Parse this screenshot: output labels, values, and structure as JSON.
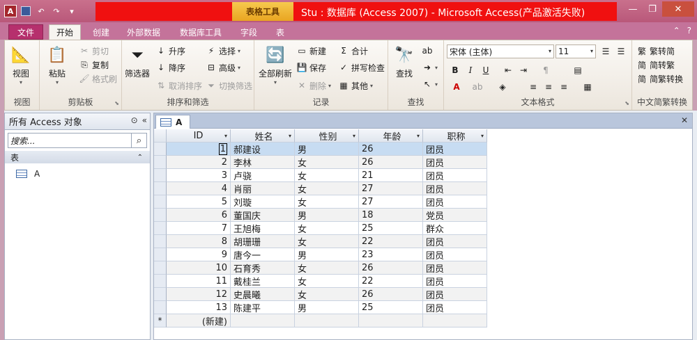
{
  "titlebar": {
    "app_icon": "A",
    "context_tab": "表格工具",
    "title": "Stu : 数据库 (Access 2007) - Microsoft Access(产品激活失败)",
    "icons": [
      "access-app-icon",
      "save-icon",
      "undo-icon",
      "redo-icon",
      "customize-qat-icon"
    ]
  },
  "tabs": [
    {
      "label": "文件"
    },
    {
      "label": "开始"
    },
    {
      "label": "创建"
    },
    {
      "label": "外部数据"
    },
    {
      "label": "数据库工具"
    },
    {
      "label": "字段"
    },
    {
      "label": "表"
    }
  ],
  "ribbon": {
    "view": {
      "button": "视图",
      "group": "视图"
    },
    "clipboard": {
      "paste": "粘贴",
      "cut": "剪切",
      "copy": "复制",
      "format_painter": "格式刷",
      "group": "剪贴板"
    },
    "sort": {
      "filter": "筛选器",
      "asc": "升序",
      "desc": "降序",
      "clear_sort": "取消排序",
      "select": "选择",
      "advanced": "高级",
      "toggle_filter": "切换筛选",
      "group": "排序和筛选"
    },
    "records": {
      "refresh": "全部刷新",
      "new": "新建",
      "save": "保存",
      "delete": "删除",
      "totals": "合计",
      "spelling": "拼写检查",
      "more": "其他",
      "group": "记录"
    },
    "find": {
      "find": "查找",
      "group": "查找"
    },
    "text": {
      "font": "宋体 (主体)",
      "size": "11",
      "group": "文本格式"
    },
    "chinese": {
      "to_simplified": "繁转简",
      "to_traditional": "简转繁",
      "convert": "简繁转换",
      "group": "中文简繁转换"
    }
  },
  "nav": {
    "title": "所有 Access 对象",
    "search_placeholder": "搜索...",
    "group": "表",
    "items": [
      {
        "name": "A"
      }
    ]
  },
  "doc": {
    "tab": "A"
  },
  "table": {
    "columns": [
      "ID",
      "姓名",
      "性别",
      "年龄",
      "职称"
    ],
    "rows": [
      {
        "id": "1",
        "name": "郝建设",
        "sex": "男",
        "age": "26",
        "title": "团员"
      },
      {
        "id": "2",
        "name": "李林",
        "sex": "女",
        "age": "26",
        "title": "团员"
      },
      {
        "id": "3",
        "name": "卢骁",
        "sex": "女",
        "age": "21",
        "title": "团员"
      },
      {
        "id": "4",
        "name": "肖丽",
        "sex": "女",
        "age": "27",
        "title": "团员"
      },
      {
        "id": "5",
        "name": "刘璇",
        "sex": "女",
        "age": "27",
        "title": "团员"
      },
      {
        "id": "6",
        "name": "董国庆",
        "sex": "男",
        "age": "18",
        "title": "党员"
      },
      {
        "id": "7",
        "name": "王旭梅",
        "sex": "女",
        "age": "25",
        "title": "群众"
      },
      {
        "id": "8",
        "name": "胡珊珊",
        "sex": "女",
        "age": "22",
        "title": "团员"
      },
      {
        "id": "9",
        "name": "唐今一",
        "sex": "男",
        "age": "23",
        "title": "团员"
      },
      {
        "id": "10",
        "name": "石育秀",
        "sex": "女",
        "age": "26",
        "title": "团员"
      },
      {
        "id": "11",
        "name": "戴桂兰",
        "sex": "女",
        "age": "22",
        "title": "团员"
      },
      {
        "id": "12",
        "name": "史晨曦",
        "sex": "女",
        "age": "26",
        "title": "团员"
      },
      {
        "id": "13",
        "name": "陈建平",
        "sex": "男",
        "age": "25",
        "title": "团员"
      }
    ],
    "new_row": {
      "marker": "*",
      "label": "(新建)"
    }
  }
}
